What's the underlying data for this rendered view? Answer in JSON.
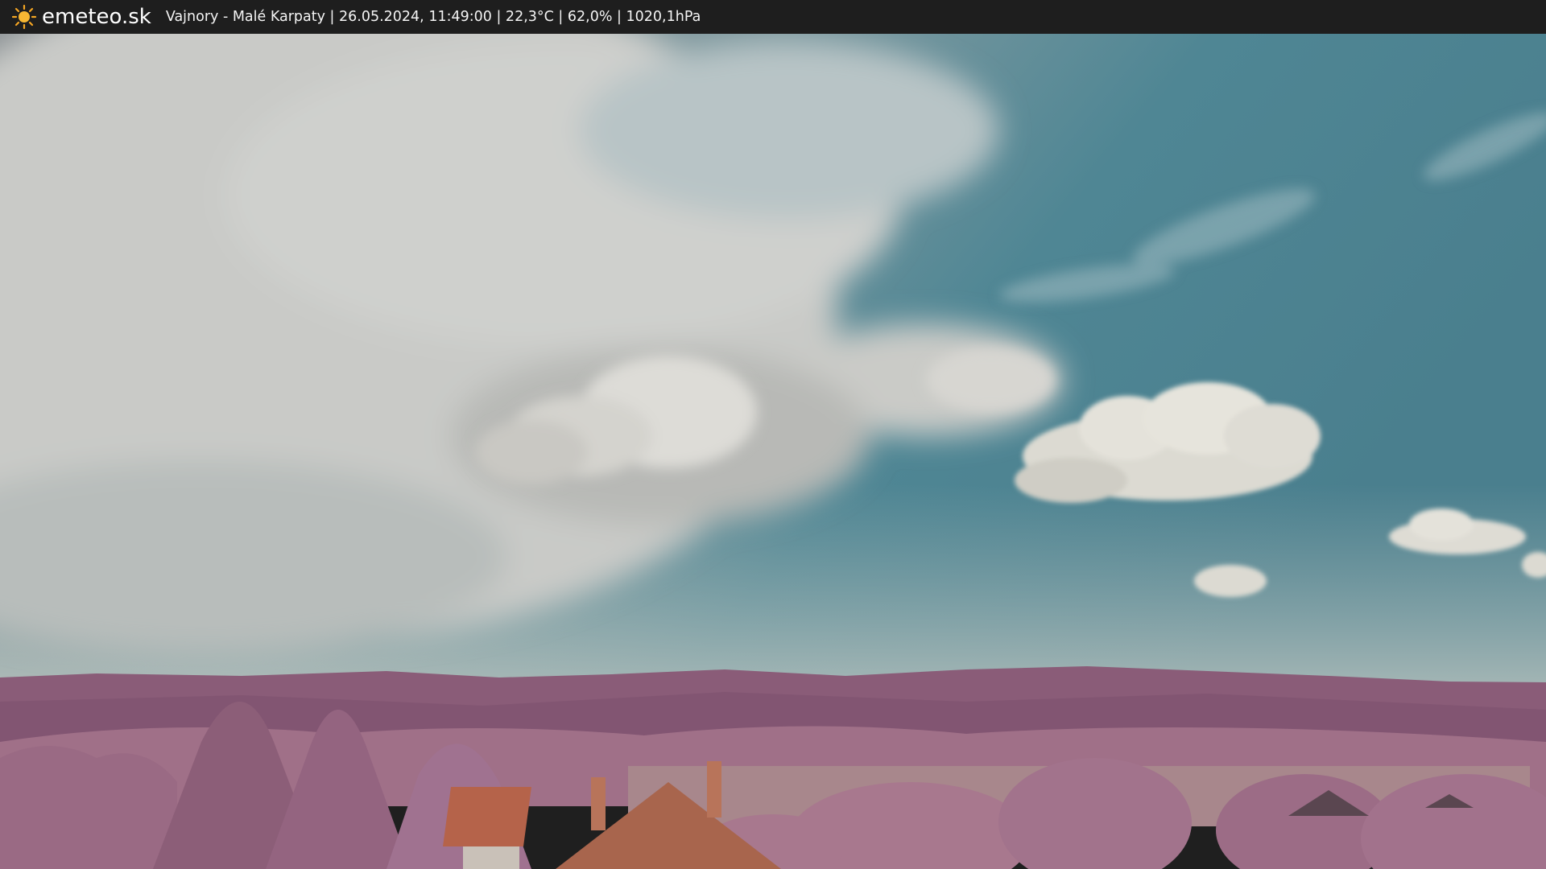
{
  "header": {
    "brand": "emeteo.sk",
    "caption": "Vajnory - Malé Karpaty | 26.05.2024, 11:49:00 | 22,3°C | 62,0% | 1020,1hPa",
    "logo_icon": "sun-icon"
  },
  "colors": {
    "bar_bg": "#1e1e1e",
    "sun": "#f5a623",
    "sky_blue": "#4f8694",
    "cloud": "#d6d4cc",
    "foliage": "#9c6a86",
    "hills": "#8a5c78",
    "roof": "#b5634a"
  }
}
